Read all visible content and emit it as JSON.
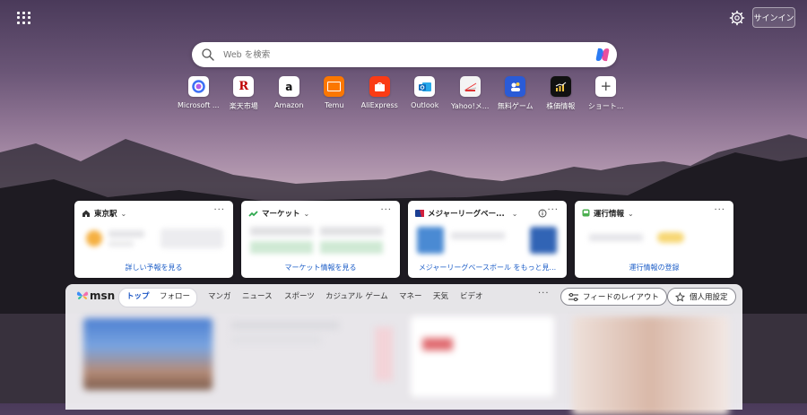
{
  "top": {
    "signin_label": "サインイン"
  },
  "search": {
    "placeholder": "Web を検索"
  },
  "shortcuts": [
    {
      "label": "Microsoft ...",
      "icon": "microsoft-365-icon"
    },
    {
      "label": "楽天市場",
      "icon": "rakuten-icon"
    },
    {
      "label": "Amazon",
      "icon": "amazon-icon"
    },
    {
      "label": "Temu",
      "icon": "temu-icon"
    },
    {
      "label": "AliExpress",
      "icon": "aliexpress-icon"
    },
    {
      "label": "Outlook",
      "icon": "outlook-icon"
    },
    {
      "label": "Yahoo!メ...",
      "icon": "yahoo-icon"
    },
    {
      "label": "無料ゲーム",
      "icon": "games-icon"
    },
    {
      "label": "株価情報",
      "icon": "stocks-icon"
    },
    {
      "label": "ショート...",
      "icon": "plus-icon"
    }
  ],
  "cards": [
    {
      "title": "東京駅",
      "icon": "home-icon",
      "link": "詳しい予報を見る"
    },
    {
      "title": "マーケット",
      "icon": "market-icon",
      "link": "マーケット情報を見る"
    },
    {
      "title": "メジャーリーグベー...",
      "icon": "mlb-icon",
      "link": "メジャーリーグベースボール をもっと見..."
    },
    {
      "title": "運行情報",
      "icon": "train-icon",
      "link": "運行情報の登録"
    }
  ],
  "feed": {
    "logo_text": "msn",
    "tabs": [
      "トップ",
      "フォロー",
      "マンガ",
      "ニュース",
      "スポーツ",
      "カジュアル ゲーム",
      "マネー",
      "天気",
      "ビデオ"
    ],
    "layout_button": "フィードのレイアウト",
    "personalize_button": "個人用設定"
  },
  "colors": {
    "accent": "#1a55c4",
    "link": "#2060c8"
  }
}
